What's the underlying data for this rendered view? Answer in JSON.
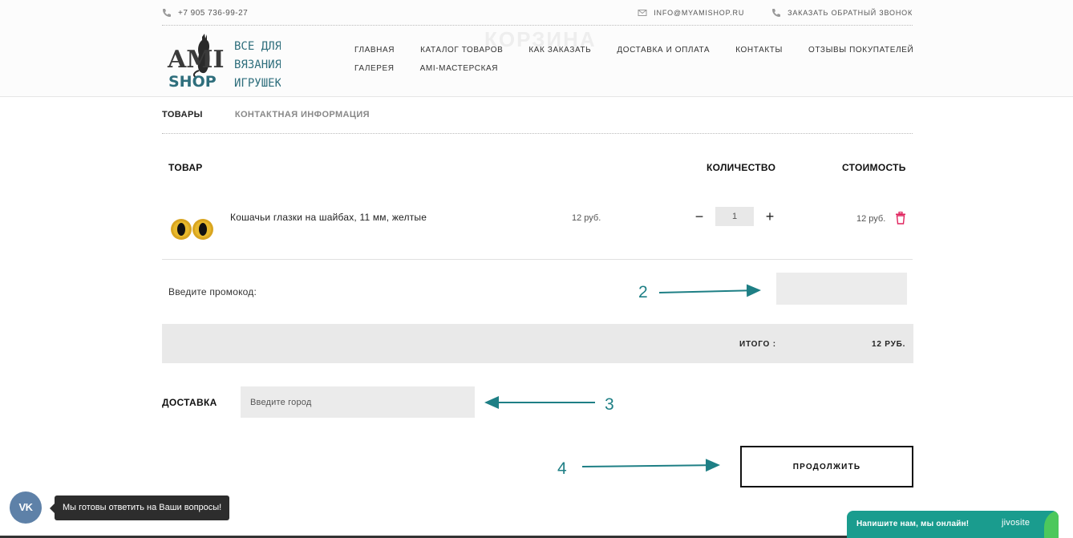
{
  "topbar": {
    "phone": "+7 905 736-99-27",
    "email": "INFO@MYAMISHOP.RU",
    "callback": "ЗАКАЗАТЬ ОБРАТНЫЙ ЗВОНОК"
  },
  "header": {
    "page_title": "КОРЗИНА",
    "logo_left": [
      "AMI",
      "SHOP"
    ],
    "logo_right": [
      "ВСЕ ДЛЯ",
      "ВЯЗАНИЯ",
      "ИГРУШЕК"
    ]
  },
  "nav": {
    "row1": [
      "ГЛАВНАЯ",
      "КАТАЛОГ ТОВАРОВ",
      "КАК ЗАКАЗАТЬ",
      "ДОСТАВКА И ОПЛАТА",
      "КОНТАКТЫ",
      "ОТЗЫВЫ ПОКУПАТЕЛЕЙ"
    ],
    "row2": [
      "ГАЛЕРЕЯ",
      "AMI-МАСТЕРСКАЯ"
    ]
  },
  "tabs": {
    "items": "ТОВАРЫ",
    "contact": "КОНТАКТНАЯ ИНФОРМАЦИЯ"
  },
  "table": {
    "headers": {
      "product": "ТОВАР",
      "quantity": "КОЛИЧЕСТВО",
      "cost": "СТОИМОСТЬ"
    },
    "rows": [
      {
        "name": "Кошачьи глазки на шайбах, 11 мм, желтые",
        "price": "12 руб.",
        "qty": "1",
        "cost": "12 руб."
      }
    ]
  },
  "promo": {
    "label": "Введите промокод:"
  },
  "total": {
    "label": "ИТОГО :",
    "value": "12 РУБ."
  },
  "delivery": {
    "label": "ДОСТАВКА",
    "placeholder": "Введите город"
  },
  "continue_label": "ПРОДОЛЖИТЬ",
  "annotations": [
    "2",
    "3",
    "4"
  ],
  "vk": {
    "label": "VK",
    "tooltip": "Мы готовы ответить на Ваши вопросы!"
  },
  "jivo": {
    "text": "Напишите нам, мы онлайн!",
    "brand": "jivosite"
  },
  "colors": {
    "annotation": "#1e7f85",
    "jivo": "#1a9c8e",
    "vk": "#5e81a8",
    "trash": "#e0245e"
  }
}
